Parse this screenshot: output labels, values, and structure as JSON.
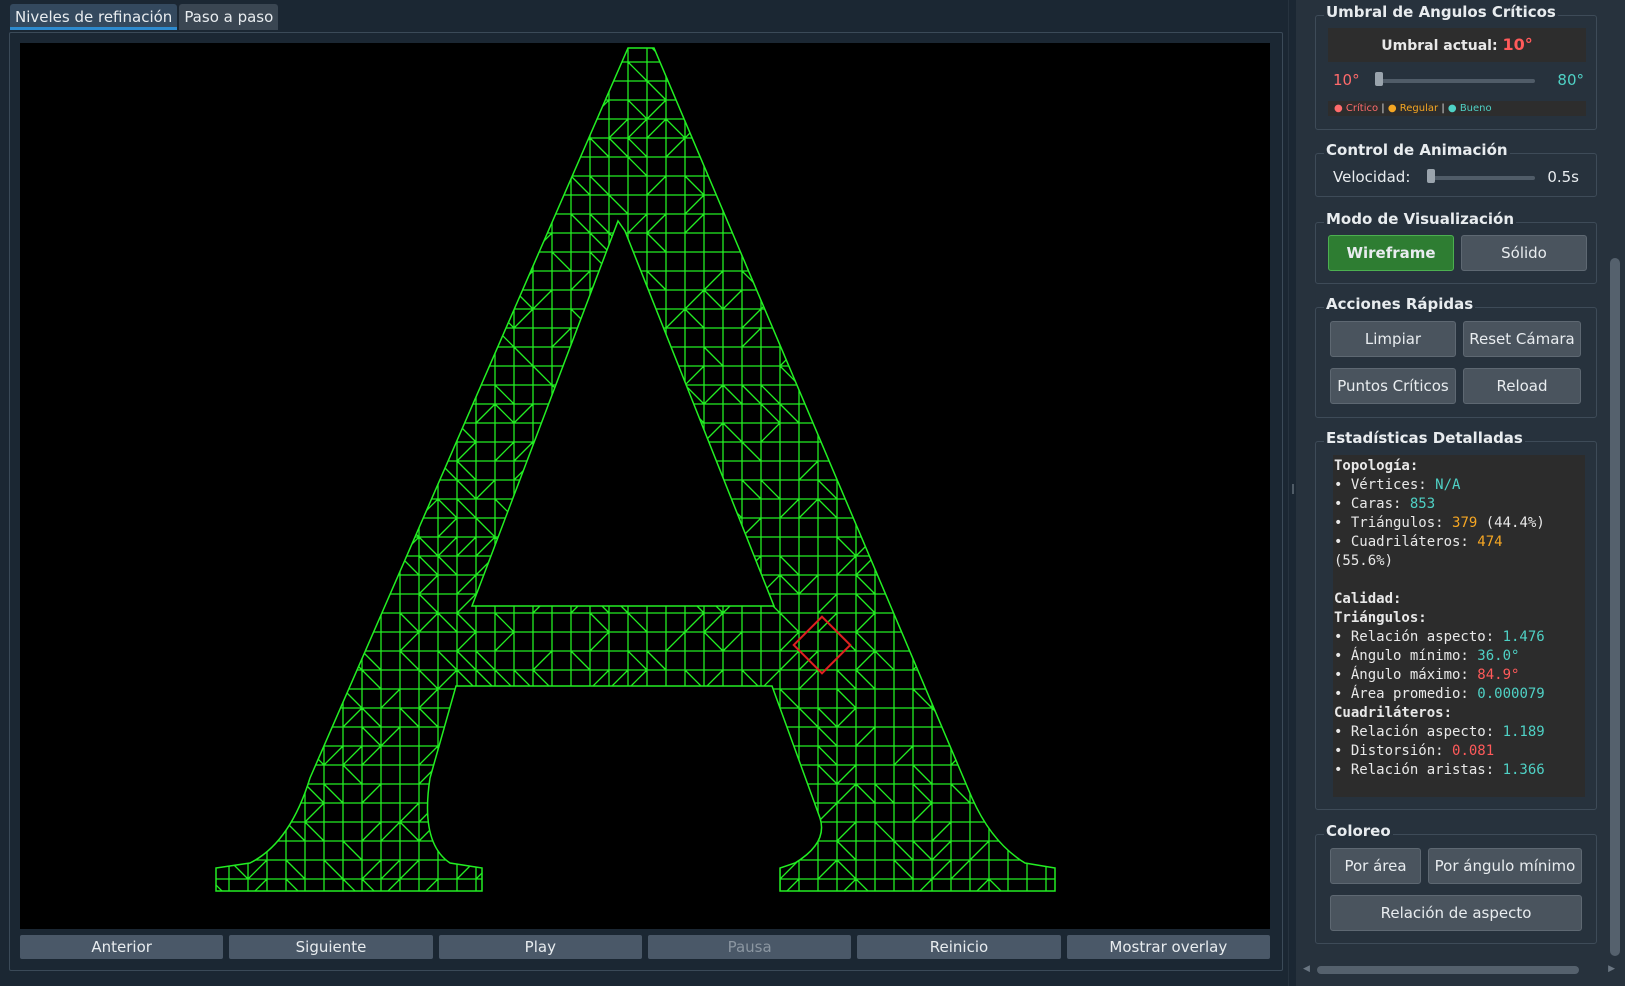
{
  "tabs": [
    {
      "label": "Niveles de refinación"
    },
    {
      "label": "Paso a paso"
    }
  ],
  "controls": {
    "prev": "Anterior",
    "next": "Siguiente",
    "play": "Play",
    "pause": "Pausa",
    "reset": "Reinicio",
    "overlay": "Mostrar overlay"
  },
  "threshold": {
    "title": "Umbral de Angulos Críticos",
    "current_label": "Umbral actual:",
    "current_value": "10°",
    "min": "10°",
    "max": "80°",
    "slider_fraction": 0,
    "legend": {
      "critical": "Crítico",
      "regular": "Regular",
      "good": "Bueno",
      "sep": "|"
    },
    "colors": {
      "critical": "#ff6b6b",
      "regular": "#f5a623",
      "good": "#4fd1c5"
    }
  },
  "animation": {
    "title": "Control de Animación",
    "speed_label": "Velocidad:",
    "speed_value": "0.5s",
    "speed_fraction": 0
  },
  "view_mode": {
    "title": "Modo de Visualización",
    "wireframe": "Wireframe",
    "solid": "Sólido",
    "active": "Wireframe"
  },
  "quick_actions": {
    "title": "Acciones Rápidas",
    "clear": "Limpiar",
    "reset_camera": "Reset Cámara",
    "critical_points": "Puntos Críticos",
    "reload": "Reload"
  },
  "stats": {
    "title": "Estadísticas Detalladas",
    "topology": "Topología:",
    "vertices_label": "• Vértices: ",
    "vertices": "N/A",
    "faces_label": "• Caras: ",
    "faces": "853",
    "triangles_label": "• Triángulos: ",
    "triangles": "379",
    "triangles_pct": " (44.4%)",
    "quads_label": "• Cuadriláteros: ",
    "quads": "474",
    "quads_pct": "(55.6%)",
    "quality": "Calidad:",
    "tri_header": "Triángulos:",
    "tri_aspect_label": "• Relación aspecto: ",
    "tri_aspect": "1.476",
    "tri_min_label": "• Ángulo mínimo: ",
    "tri_min": "36.0°",
    "tri_max_label": "• Ángulo máximo: ",
    "tri_max": "84.9°",
    "tri_area_label": "• Área promedio: ",
    "tri_area": "0.000079",
    "quad_header": "Cuadriláteros:",
    "quad_aspect_label": "• Relación aspecto: ",
    "quad_aspect": "1.189",
    "quad_dist_label": "• Distorsión: ",
    "quad_dist": "0.081",
    "quad_edges_label": "• Relación aristas: ",
    "quad_edges": "1.366"
  },
  "coloring": {
    "title": "Coloreo",
    "by_area": "Por área",
    "by_min_angle": "Por ángulo mínimo",
    "aspect_ratio": "Relación de aspecto"
  },
  "mesh_colors": {
    "wire": "#22ee22",
    "highlight": "#e02020",
    "background": "#000000"
  }
}
